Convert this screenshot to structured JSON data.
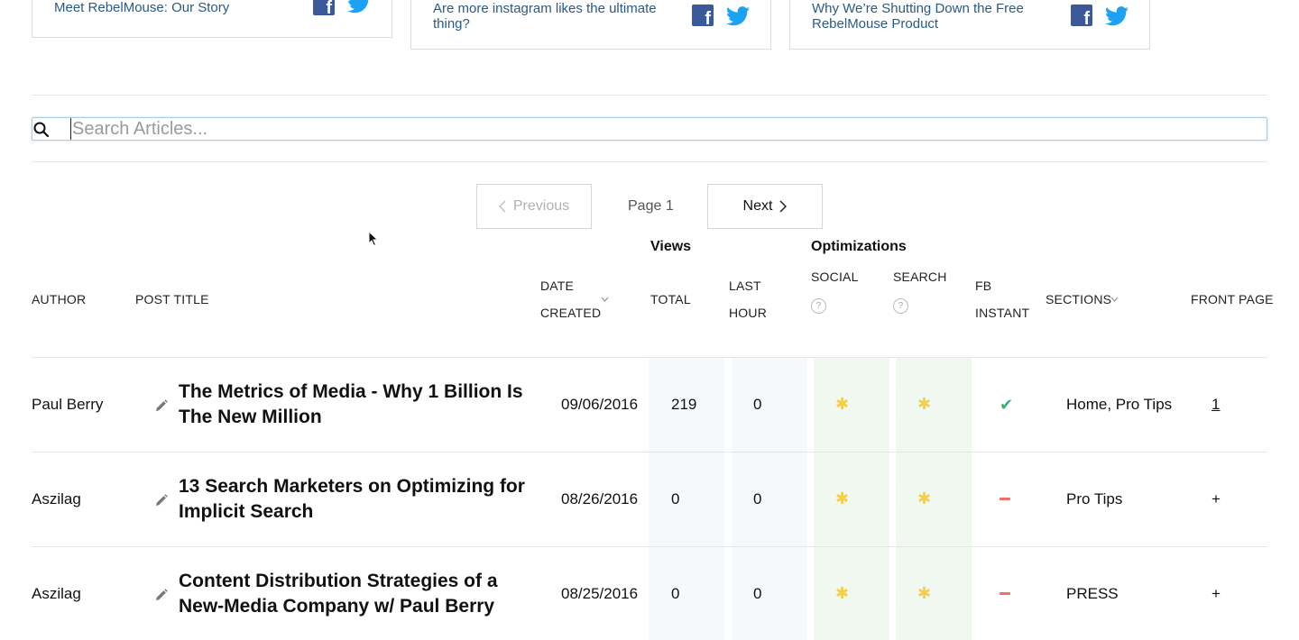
{
  "cards": [
    {
      "title": "Meet RebelMouse: Our Story"
    },
    {
      "title": "Are more instagram likes the ultimate thing?"
    },
    {
      "title": "Why We’re Shutting Down the Free RebelMouse Product"
    }
  ],
  "search": {
    "placeholder": "Search Articles..."
  },
  "pagination": {
    "previous": "Previous",
    "page": "Page 1",
    "next": "Next"
  },
  "table": {
    "groups": {
      "views": "Views",
      "optimizations": "Optimizations"
    },
    "headers": {
      "author": "AUTHOR",
      "post_title": "POST TITLE",
      "date_created_1": "DATE",
      "date_created_2": "CREATED",
      "total": "TOTAL",
      "last_hour_1": "LAST",
      "last_hour_2": "HOUR",
      "social": "SOCIAL",
      "search": "SEARCH",
      "fb_instant_1": "FB",
      "fb_instant_2": "INSTANT",
      "sections": "SECTIONS",
      "front_page": "FRONT PAGE"
    },
    "rows": [
      {
        "author": "Paul Berry",
        "title": "The Metrics of Media - Why 1 Billion Is The New Million",
        "date": "09/06/2016",
        "total": "219",
        "last_hour": "0",
        "social": "✱",
        "search": "✱",
        "fb_instant": "check",
        "sections": "Home, Pro Tips",
        "front_page": "1"
      },
      {
        "author": "Aszilag",
        "title": "13 Search Marketers on Optimizing for Implicit Search",
        "date": "08/26/2016",
        "total": "0",
        "last_hour": "0",
        "social": "✱",
        "search": "✱",
        "fb_instant": "dash",
        "sections": "Pro Tips",
        "front_page": "+"
      },
      {
        "author": "Aszilag",
        "title": "Content Distribution Strategies of a New-Media Company w/ Paul Berry",
        "date": "08/25/2016",
        "total": "0",
        "last_hour": "0",
        "social": "✱",
        "search": "✱",
        "fb_instant": "dash",
        "sections": "PRESS",
        "front_page": "+"
      }
    ]
  },
  "icons": {
    "check": "✔",
    "question": "?"
  },
  "colors": {
    "link": "#2a5a86",
    "facebook": "#3b5998",
    "twitter": "#1da1f2",
    "star": "#f5cf4a",
    "check": "#3cae6e",
    "dash": "#ee7166"
  }
}
